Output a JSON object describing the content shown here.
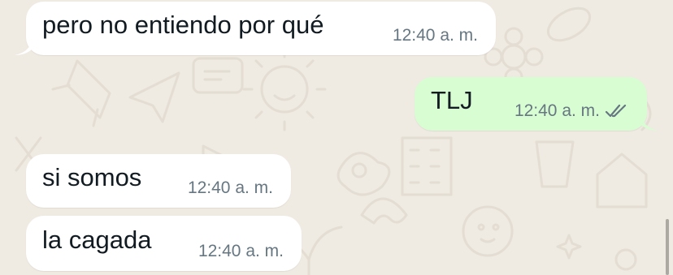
{
  "chat": {
    "theme": {
      "background": "#efeae2",
      "incoming_bubble": "#ffffff",
      "outgoing_bubble": "#d9fdd3",
      "read_tick": "#667781"
    },
    "messages": [
      {
        "direction": "incoming",
        "text": "pero no entiendo por qué",
        "time": "12:40 a. m."
      },
      {
        "direction": "outgoing",
        "text": "TLJ",
        "time": "12:40 a. m.",
        "status": "read-double-check"
      },
      {
        "direction": "incoming",
        "text": "si somos",
        "time": "12:40 a. m."
      },
      {
        "direction": "incoming",
        "text": "la cagada",
        "time": "12:40 a. m."
      }
    ]
  }
}
